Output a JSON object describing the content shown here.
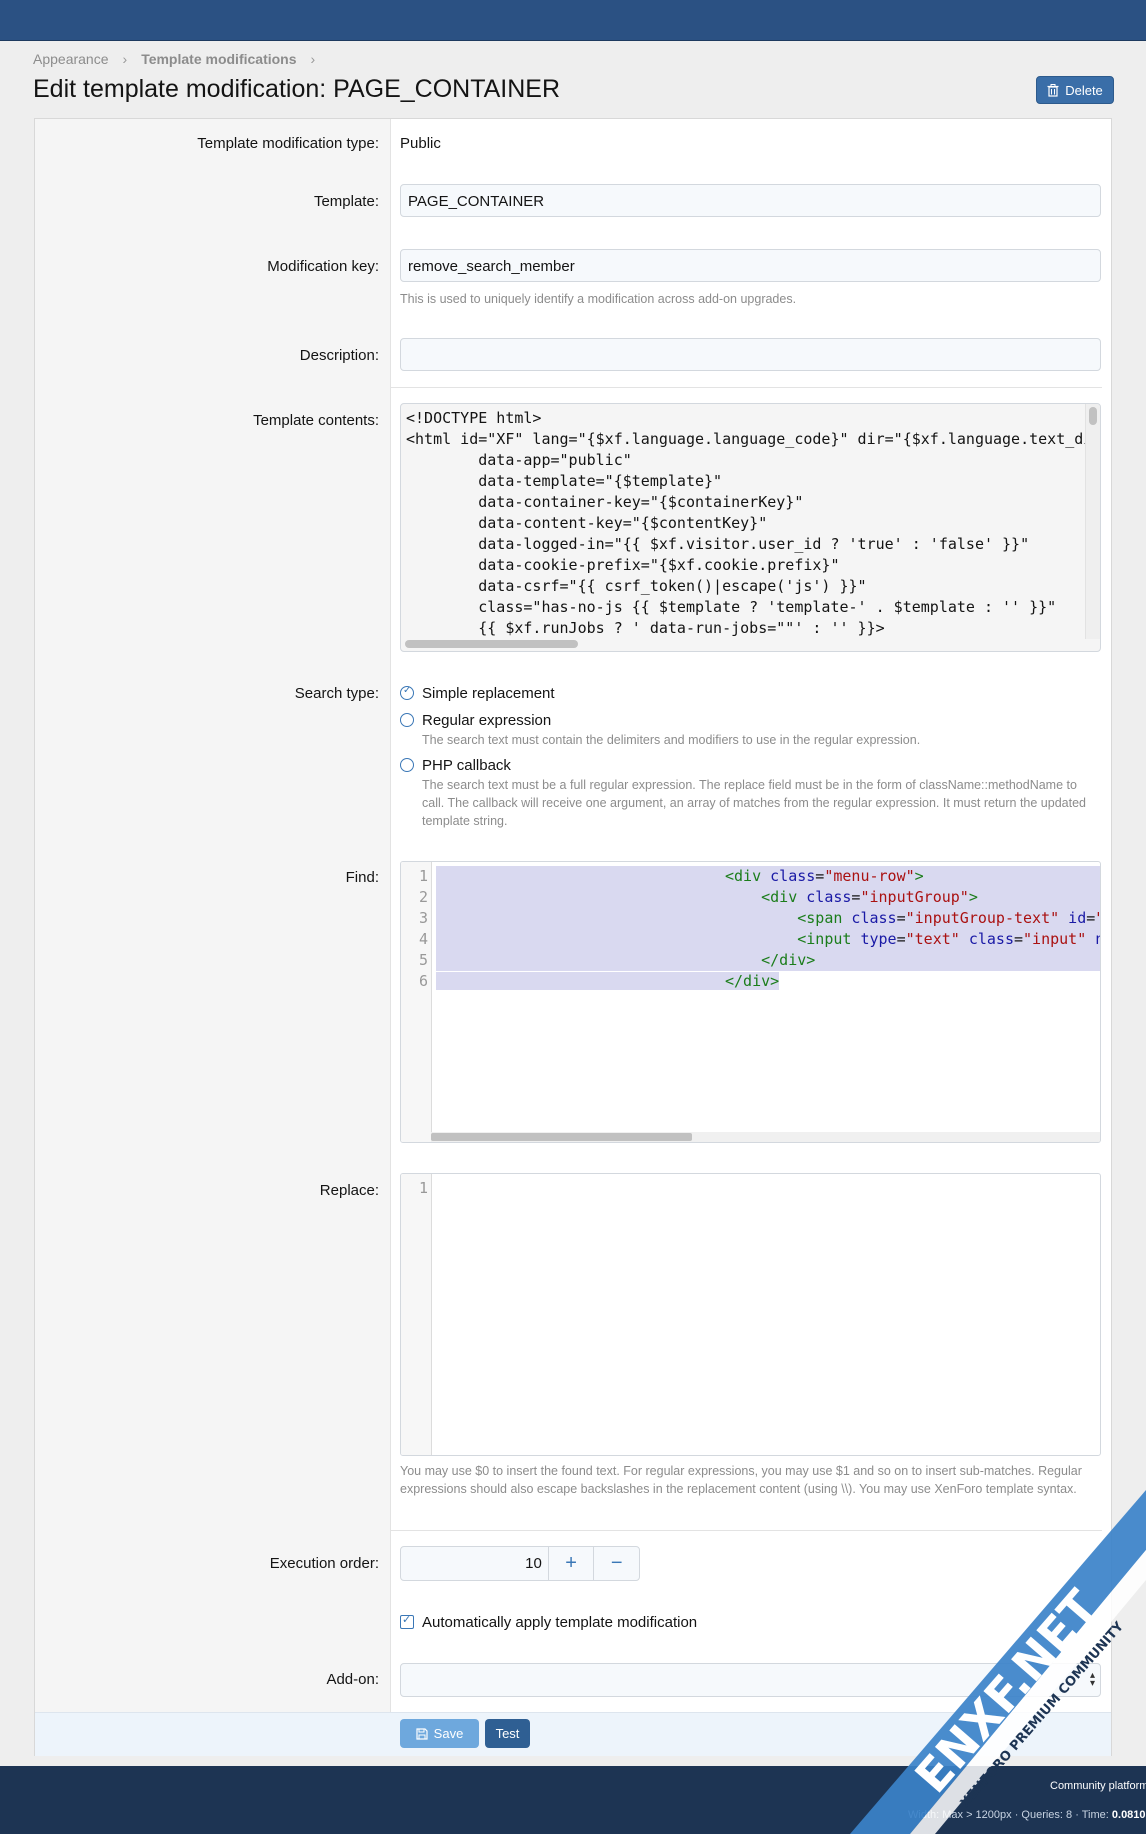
{
  "breadcrumb": {
    "items": [
      "Appearance",
      "Template modifications"
    ]
  },
  "page": {
    "title": "Edit template modification: PAGE_CONTAINER",
    "delete_label": "Delete"
  },
  "fields": {
    "type_label": "Template modification type:",
    "type_value": "Public",
    "template_label": "Template:",
    "template_value": "PAGE_CONTAINER",
    "key_label": "Modification key:",
    "key_value": "remove_search_member",
    "key_hint": "This is used to uniquely identify a modification across add-on upgrades.",
    "description_label": "Description:",
    "description_value": "",
    "contents_label": "Template contents:",
    "contents_lines": [
      "<!DOCTYPE html>",
      "<html id=\"XF\" lang=\"{$xf.language.language_code}\" dir=\"{$xf.language.text_di",
      "        data-app=\"public\"",
      "        data-template=\"{$template}\"",
      "        data-container-key=\"{$containerKey}\"",
      "        data-content-key=\"{$contentKey}\"",
      "        data-logged-in=\"{{ $xf.visitor.user_id ? 'true' : 'false' }}\"",
      "        data-cookie-prefix=\"{$xf.cookie.prefix}\"",
      "        data-csrf=\"{{ csrf_token()|escape('js') }}\"",
      "        class=\"has-no-js {{ $template ? 'template-' . $template : '' }}\"",
      "        {{ $xf.runJobs ? ' data-run-jobs=\"\"' : '' }}>"
    ],
    "search_type_label": "Search type:",
    "search_options": [
      {
        "label": "Simple replacement",
        "checked": true,
        "hint": ""
      },
      {
        "label": "Regular expression",
        "checked": false,
        "hint": "The search text must contain the delimiters and modifiers to use in the regular expression."
      },
      {
        "label": "PHP callback",
        "checked": false,
        "hint": "The search text must be a full regular expression. The replace field must be in the form of className::methodName to call. The callback will receive one argument, an array of matches from the regular expression. It must return the updated template string."
      }
    ],
    "find_label": "Find:",
    "find_line_numbers": [
      "1",
      "2",
      "3",
      "4",
      "5",
      "6"
    ],
    "replace_label": "Replace:",
    "replace_line_numbers": [
      "1"
    ],
    "replace_hint": "You may use $0 to insert the found text. For regular expressions, you may use $1 and so on to insert sub-matches. Regular expressions should also escape backslashes in the replacement content (using \\\\). You may use XenForo template syntax.",
    "order_label": "Execution order:",
    "order_value": "10",
    "auto_apply_label": "Automatically apply template modification",
    "addon_label": "Add-on:",
    "addon_value": ""
  },
  "buttons": {
    "save": "Save",
    "test": "Test"
  },
  "footer": {
    "platform": "Community platform",
    "stats_prefix": "Width: Max > 1200px · Queries: 8 · Time:",
    "stats_time": "0.0810"
  },
  "watermark": {
    "brand": "ENXF.NET",
    "tagline": "XENFORO PREMIUM COMMUNITY"
  },
  "colors": {
    "header": "#2b5183",
    "footer": "#1d3453",
    "accent": "#3a77b6"
  }
}
